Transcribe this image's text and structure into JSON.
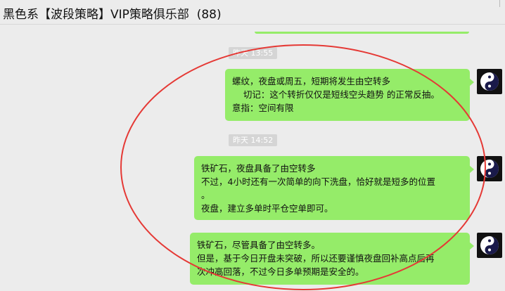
{
  "header": {
    "title": "黑色系【波段策略】VIP策略俱乐部",
    "count": "(88)"
  },
  "messages": [
    {
      "timestamp": "昨天 13:55",
      "lines": [
        "螺纹，夜盘或周五，短期将发生由空转多",
        "    切记：这个转折仅仅是短线空头趋势 的正常反抽。",
        "意指：空间有限"
      ]
    },
    {
      "timestamp": "昨天 14:52",
      "lines": [
        "铁矿石，夜盘具备了由空转多",
        "不过，4小时还有一次简单的向下洗盘，恰好就是短多的位置",
        "。",
        "夜盘，建立多单时平仓空单即可。"
      ]
    },
    {
      "timestamp": "",
      "lines": [
        "铁矿石，尽管具备了由空转多。",
        "但是，基于今日开盘未突破，所以还要谨慎夜盘回补高点后再",
        "次冲高回落，不过今日多单预期是安全的。"
      ]
    }
  ],
  "avatar": {
    "icon": "yin-yang-icon"
  },
  "colors": {
    "bubble": "#95ec69",
    "background": "#ececec",
    "annotation": "#e53935"
  }
}
